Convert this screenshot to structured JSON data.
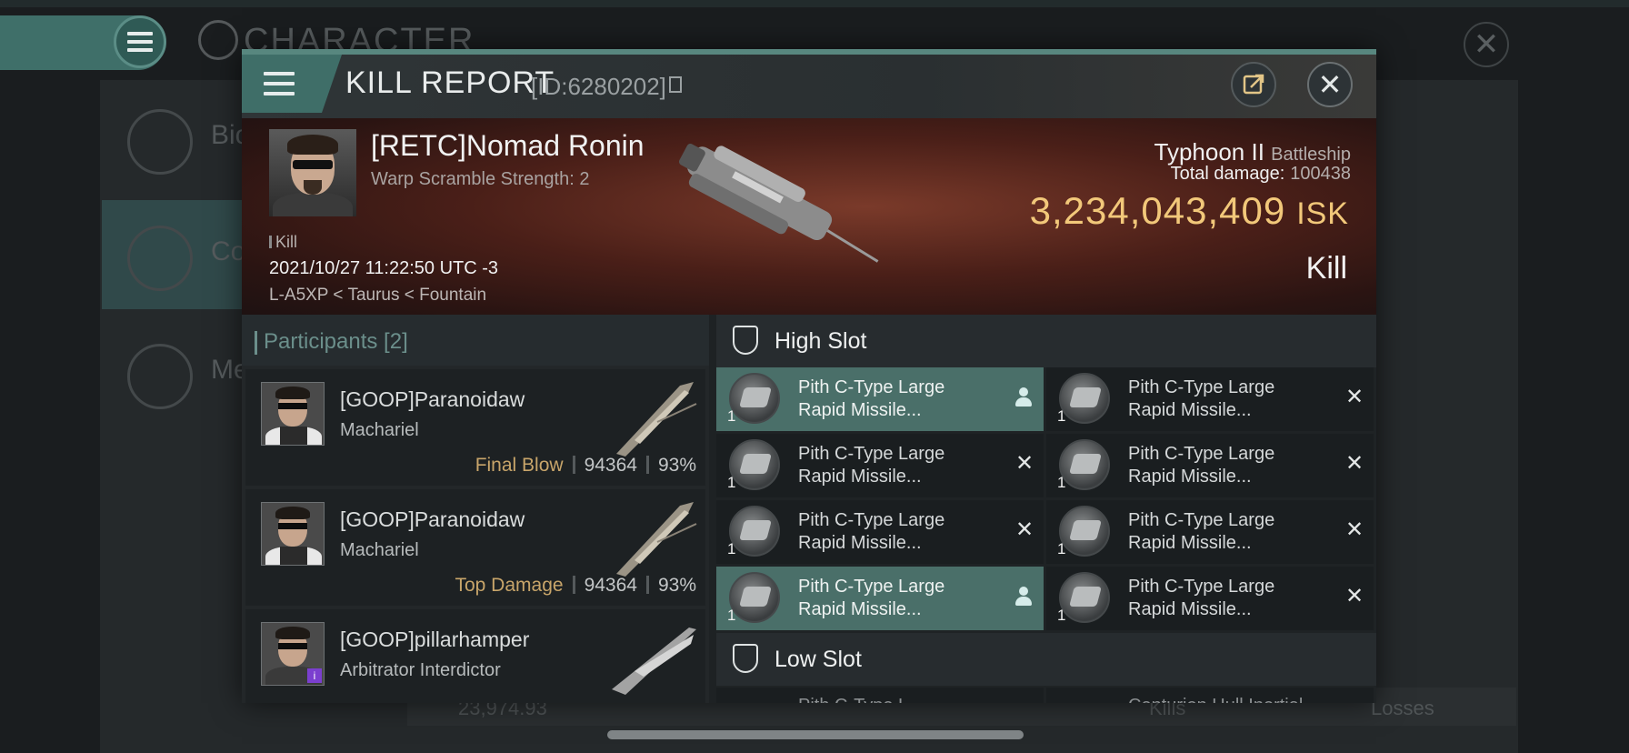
{
  "background": {
    "title": "CHARACTER",
    "side_items": [
      "Bio",
      "Co",
      "Me"
    ],
    "bottom": {
      "value": "23,974.93",
      "kills": "Kills",
      "losses": "Losses"
    }
  },
  "report": {
    "title": "KILL REPORT",
    "id": "[ID:6280202]",
    "victim": {
      "name": "[RETC]Nomad Ronin",
      "subtitle": "Warp Scramble Strength: 2",
      "tag": "Kill",
      "datetime": "2021/10/27 11:22:50 UTC -3",
      "location": "L-A5XP < Taurus < Fountain"
    },
    "ship": {
      "name": "Typhoon II",
      "class": "Battleship",
      "damage_label": "Total damage:",
      "damage_value": "100438",
      "isk_value": "3,234,043,409",
      "isk_unit": "ISK",
      "result": "Kill"
    }
  },
  "participants": {
    "title": "Participants [2]",
    "rows": [
      {
        "name": "[GOOP]Paranoidaw",
        "ship": "Machariel",
        "label": "Final Blow",
        "damage": "94364",
        "percent": "93%"
      },
      {
        "name": "[GOOP]Paranoidaw",
        "ship": "Machariel",
        "label": "Top Damage",
        "damage": "94364",
        "percent": "93%"
      },
      {
        "name": "[GOOP]pillarhamper",
        "ship": "Arbitrator Interdictor",
        "label": "",
        "damage": "",
        "percent": ""
      }
    ]
  },
  "fittings": {
    "high_slot": "High Slot",
    "low_slot": "Low Slot",
    "module_line1": "Pith C-Type Large",
    "module_line2": "Rapid Missile...",
    "quantity": "1",
    "low_left": "Pith C-Type L...",
    "low_right": "Centurion Hull Inertial..."
  },
  "colors": {
    "accent": "#4a6f69",
    "isk": "#f2c87a",
    "final_blow": "#c8a56a"
  }
}
